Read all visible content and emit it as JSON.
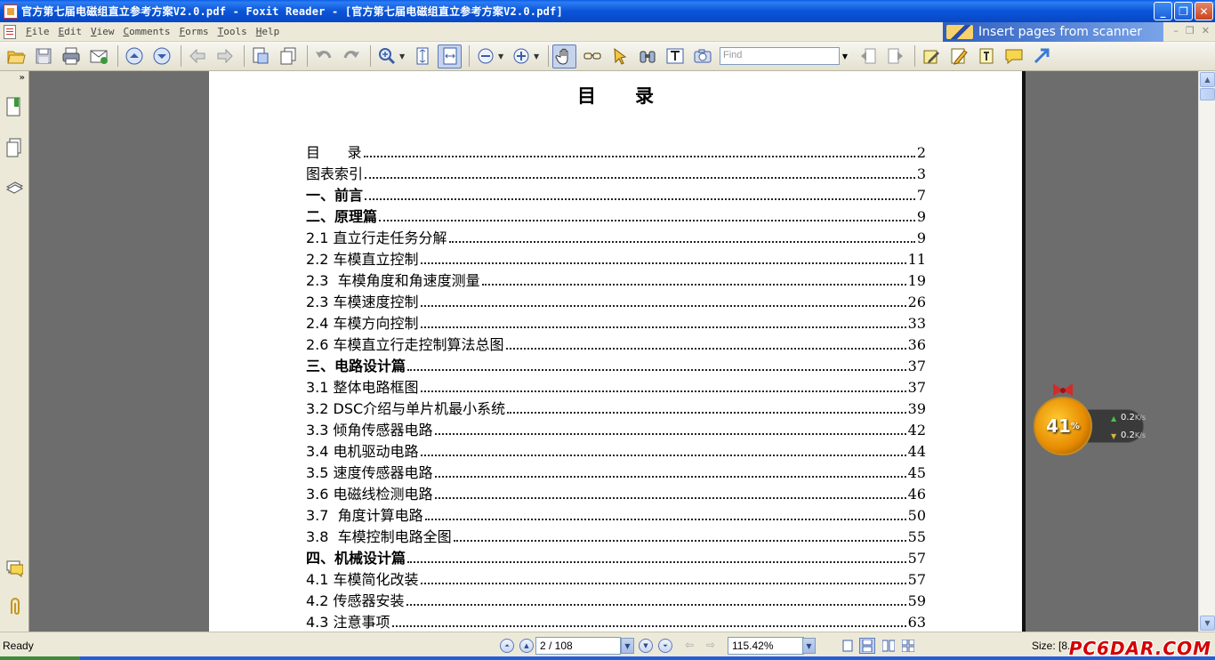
{
  "window": {
    "title": "官方第七届电磁组直立参考方案V2.0.pdf - Foxit Reader - [官方第七届电磁组直立参考方案V2.0.pdf]",
    "minimize": "_",
    "restore": "❐",
    "close": "✕"
  },
  "menu": {
    "items": [
      {
        "u": "F",
        "rest": "ile"
      },
      {
        "u": "E",
        "rest": "dit"
      },
      {
        "u": "V",
        "rest": "iew"
      },
      {
        "u": "C",
        "rest": "omments"
      },
      {
        "u": "F",
        "rest": "orms"
      },
      {
        "u": "T",
        "rest": "ools"
      },
      {
        "u": "H",
        "rest": "elp"
      }
    ],
    "banner": "Insert pages from scanner"
  },
  "toolbar": {
    "find_placeholder": "Find"
  },
  "page": {
    "heading": "目录",
    "toc": [
      {
        "title": "目      录",
        "page": "2",
        "bold": false
      },
      {
        "title": "图表索引",
        "page": "3",
        "bold": false
      },
      {
        "title": "一、前言",
        "page": "7",
        "bold": true
      },
      {
        "title": "二、原理篇",
        "page": "9",
        "bold": true
      },
      {
        "title": "2.1 直立行走任务分解",
        "page": "9",
        "bold": false
      },
      {
        "title": "2.2 车模直立控制",
        "page": "11",
        "bold": false
      },
      {
        "title": "2.3  车模角度和角速度测量",
        "page": "19",
        "bold": false
      },
      {
        "title": "2.3 车模速度控制",
        "page": "26",
        "bold": false
      },
      {
        "title": "2.4 车模方向控制",
        "page": "33",
        "bold": false
      },
      {
        "title": "2.6 车模直立行走控制算法总图",
        "page": "36",
        "bold": false
      },
      {
        "title": "三、电路设计篇",
        "page": "37",
        "bold": true
      },
      {
        "title": "3.1 整体电路框图",
        "page": "37",
        "bold": false
      },
      {
        "title": "3.2 DSC介绍与单片机最小系统",
        "page": "39",
        "bold": false
      },
      {
        "title": "3.3 倾角传感器电路",
        "page": "42",
        "bold": false
      },
      {
        "title": "3.4 电机驱动电路",
        "page": "44",
        "bold": false
      },
      {
        "title": "3.5 速度传感器电路",
        "page": "45",
        "bold": false
      },
      {
        "title": "3.6 电磁线检测电路",
        "page": "46",
        "bold": false
      },
      {
        "title": "3.7  角度计算电路",
        "page": "50",
        "bold": false
      },
      {
        "title": "3.8  车模控制电路全图",
        "page": "55",
        "bold": false
      },
      {
        "title": "四、机械设计篇",
        "page": "57",
        "bold": true
      },
      {
        "title": "4.1 车模简化改装",
        "page": "57",
        "bold": false
      },
      {
        "title": "4.2 传感器安装",
        "page": "59",
        "bold": false
      },
      {
        "title": "4.3 注意事项",
        "page": "63",
        "bold": false
      }
    ]
  },
  "speed_widget": {
    "percent": "41",
    "percent_sign": "%",
    "upload": "0.2",
    "download": "0.2",
    "unit": "K/s"
  },
  "status": {
    "ready": "Ready",
    "page_indicator": "2 / 108",
    "zoom": "115.42%",
    "size_label": "Size: [8.27",
    "watermark": "PC6DAR.COM"
  }
}
